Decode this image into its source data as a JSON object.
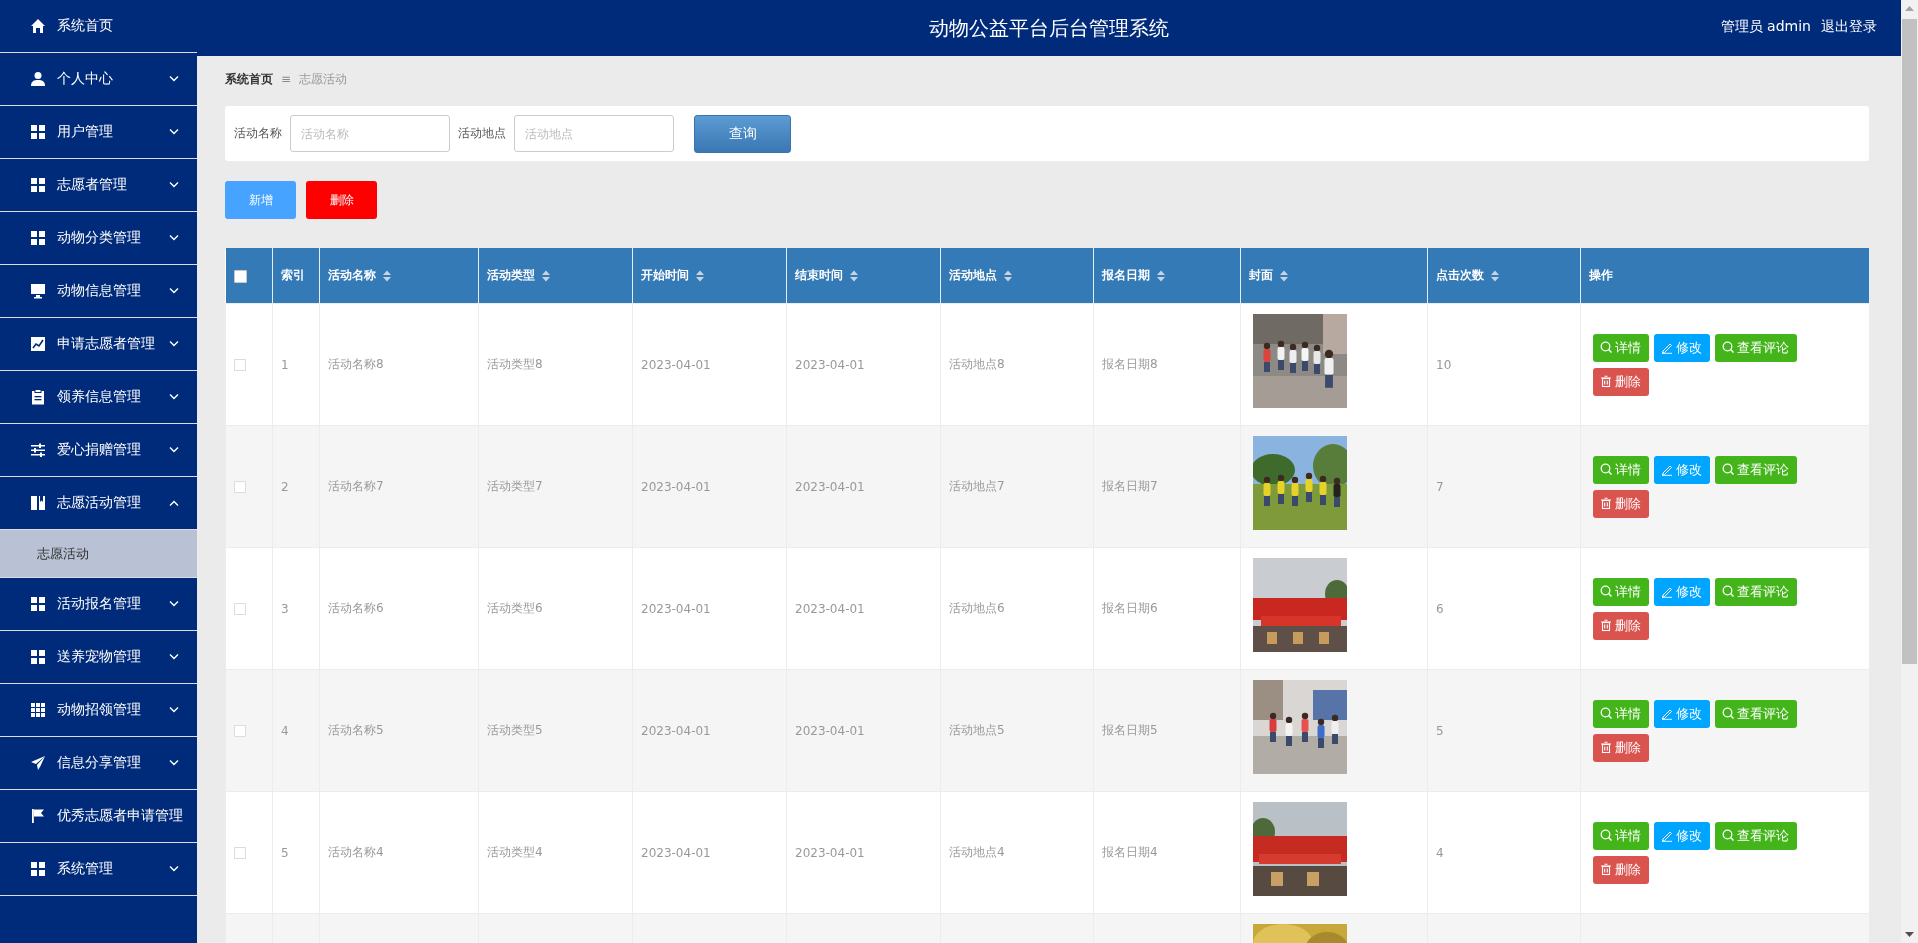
{
  "sidebar": {
    "items": [
      {
        "label": "系统首页"
      },
      {
        "label": "个人中心",
        "expanded": false
      },
      {
        "label": "用户管理",
        "expanded": false
      },
      {
        "label": "志愿者管理",
        "expanded": false
      },
      {
        "label": "动物分类管理",
        "expanded": false
      },
      {
        "label": "动物信息管理",
        "expanded": false
      },
      {
        "label": "申请志愿者管理",
        "expanded": false
      },
      {
        "label": "领养信息管理",
        "expanded": false
      },
      {
        "label": "爱心捐赠管理",
        "expanded": false
      },
      {
        "label": "志愿活动管理",
        "expanded": true,
        "children": [
          {
            "label": "志愿活动",
            "selected": true
          }
        ]
      },
      {
        "label": "活动报名管理",
        "expanded": false
      },
      {
        "label": "送养宠物管理",
        "expanded": false
      },
      {
        "label": "动物招领管理",
        "expanded": false
      },
      {
        "label": "信息分享管理",
        "expanded": false
      },
      {
        "label": "优秀志愿者申请管理"
      },
      {
        "label": "系统管理",
        "expanded": false
      }
    ]
  },
  "header": {
    "title": "动物公益平台后台管理系统",
    "user": "管理员 admin",
    "logout": "退出登录"
  },
  "breadcrumb": {
    "home": "系统首页",
    "separator": "≡",
    "current": "志愿活动"
  },
  "search": {
    "fields": [
      {
        "label": "活动名称",
        "placeholder": "活动名称"
      },
      {
        "label": "活动地点",
        "placeholder": "活动地点"
      }
    ],
    "button": "查询"
  },
  "toolbar": [
    {
      "kind": "add",
      "label": "新增"
    },
    {
      "kind": "delete",
      "label": "删除"
    }
  ],
  "table": {
    "select_all": {
      "checked": false
    },
    "columns": [
      {
        "label": "索引",
        "sortable": false
      },
      {
        "label": "活动名称",
        "sortable": true
      },
      {
        "label": "活动类型",
        "sortable": true
      },
      {
        "label": "开始时间",
        "sortable": true
      },
      {
        "label": "结束时间",
        "sortable": true
      },
      {
        "label": "活动地点",
        "sortable": true
      },
      {
        "label": "报名日期",
        "sortable": true
      },
      {
        "label": "封面",
        "sortable": true
      },
      {
        "label": "点击次数",
        "sortable": true
      },
      {
        "label": "操作",
        "sortable": false
      }
    ],
    "rows": [
      {
        "checked": false,
        "index": "1",
        "name": "活动名称8",
        "type": "活动类型8",
        "start": "2023-04-01",
        "end": "2023-04-01",
        "place": "活动地点8",
        "signup": "报名日期8",
        "cover": {
          "kind": "picture"
        },
        "clicks": "10",
        "actions": [
          {
            "kind": "view",
            "label": "详情"
          },
          {
            "kind": "edit",
            "label": "修改"
          },
          {
            "kind": "view",
            "label": "查看评论"
          },
          {
            "kind": "delete",
            "label": "删除"
          }
        ]
      },
      {
        "checked": false,
        "index": "2",
        "name": "活动名称7",
        "type": "活动类型7",
        "start": "2023-04-01",
        "end": "2023-04-01",
        "place": "活动地点7",
        "signup": "报名日期7",
        "cover": {
          "kind": "picture"
        },
        "clicks": "7",
        "actions": [
          {
            "kind": "view",
            "label": "详情"
          },
          {
            "kind": "edit",
            "label": "修改"
          },
          {
            "kind": "view",
            "label": "查看评论"
          },
          {
            "kind": "delete",
            "label": "删除"
          }
        ]
      },
      {
        "checked": false,
        "index": "3",
        "name": "活动名称6",
        "type": "活动类型6",
        "start": "2023-04-01",
        "end": "2023-04-01",
        "place": "活动地点6",
        "signup": "报名日期6",
        "cover": {
          "kind": "picture"
        },
        "clicks": "6",
        "actions": [
          {
            "kind": "view",
            "label": "详情"
          },
          {
            "kind": "edit",
            "label": "修改"
          },
          {
            "kind": "view",
            "label": "查看评论"
          },
          {
            "kind": "delete",
            "label": "删除"
          }
        ]
      },
      {
        "checked": false,
        "index": "4",
        "name": "活动名称5",
        "type": "活动类型5",
        "start": "2023-04-01",
        "end": "2023-04-01",
        "place": "活动地点5",
        "signup": "报名日期5",
        "cover": {
          "kind": "picture"
        },
        "clicks": "5",
        "actions": [
          {
            "kind": "view",
            "label": "详情"
          },
          {
            "kind": "edit",
            "label": "修改"
          },
          {
            "kind": "view",
            "label": "查看评论"
          },
          {
            "kind": "delete",
            "label": "删除"
          }
        ]
      },
      {
        "checked": false,
        "index": "5",
        "name": "活动名称4",
        "type": "活动类型4",
        "start": "2023-04-01",
        "end": "2023-04-01",
        "place": "活动地点4",
        "signup": "报名日期4",
        "cover": {
          "kind": "picture"
        },
        "clicks": "4",
        "actions": [
          {
            "kind": "view",
            "label": "详情"
          },
          {
            "kind": "edit",
            "label": "修改"
          },
          {
            "kind": "view",
            "label": "查看评论"
          },
          {
            "kind": "delete",
            "label": "删除"
          }
        ]
      },
      {
        "cover": {
          "kind": "picture"
        }
      }
    ]
  }
}
